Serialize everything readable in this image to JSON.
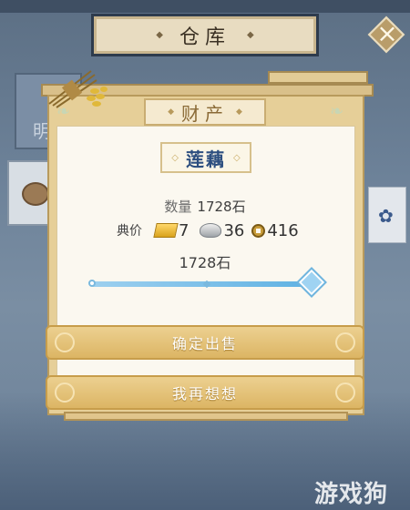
{
  "background": {
    "warehouse_title": "仓库",
    "partial_text": "明"
  },
  "dialog": {
    "title": "财产",
    "item_name": "莲藕",
    "quantity_label": "数量",
    "quantity_value": "1728石",
    "price_label": "典价",
    "price": {
      "gold": "7",
      "silver": "36",
      "copper": "416"
    },
    "sell_amount": "1728石",
    "slider_fraction": 1.0,
    "confirm_label": "确定出售",
    "cancel_label": "我再想想"
  },
  "watermark": "游戏狗",
  "colors": {
    "item_name": "#2d4f80",
    "button_gold": "#dcb564",
    "slider": "#5fb2e3"
  }
}
